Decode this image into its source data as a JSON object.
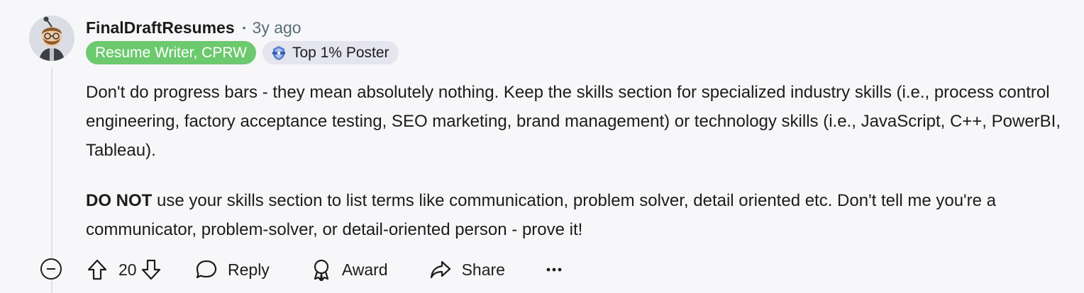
{
  "comment": {
    "username": "FinalDraftResumes",
    "separator": "•",
    "timestamp": "3y ago",
    "flairs": {
      "writer": "Resume Writer, CPRW",
      "poster": "Top 1% Poster"
    },
    "body": {
      "paragraph_1": "Don't do progress bars - they mean absolutely nothing. Keep the skills section for specialized industry skills (i.e., process control engineering, factory acceptance testing, SEO marketing, brand management) or technology skills (i.e., JavaScript, C++, PowerBI, Tableau).",
      "paragraph_2_bold": "DO NOT",
      "paragraph_2_rest": " use your skills section to list terms like communication, problem solver, detail oriented etc. Don't tell me you're a communicator, problem-solver, or detail-oriented person - prove it!"
    },
    "actions": {
      "score": "20",
      "reply_label": "Reply",
      "award_label": "Award",
      "share_label": "Share"
    }
  },
  "icons": {
    "collapse": "minus-circle-icon",
    "upvote": "arrow-up-icon",
    "downvote": "arrow-down-icon",
    "reply": "speech-bubble-icon",
    "award": "award-ribbon-icon",
    "share": "share-arrow-icon",
    "more": "ellipsis-icon",
    "badge": "top-poster-badge-icon"
  },
  "colors": {
    "background": "#f7f6f8",
    "flair_green": "#6cc96e",
    "flair_grey": "#e4e5ee",
    "muted_text": "#576f76",
    "thread_line": "#dfe1e5"
  }
}
